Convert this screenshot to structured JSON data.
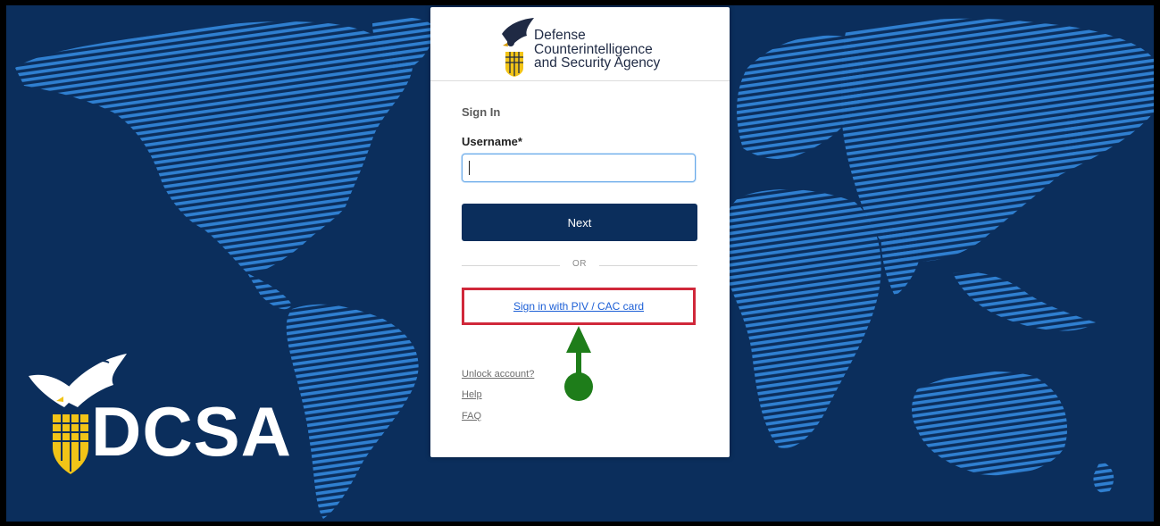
{
  "brand": {
    "wordmark": "DCSA"
  },
  "agency": {
    "line1": "Defense",
    "line2": "Counterintelligence",
    "line3": "and Security Agency"
  },
  "form": {
    "title": "Sign In",
    "username_label": "Username*",
    "username_value": "",
    "next_label": "Next",
    "divider_text": "OR",
    "piv_link": "Sign in with PIV / CAC card"
  },
  "links": {
    "unlock": "Unlock account?",
    "help": "Help",
    "faq": "FAQ"
  },
  "colors": {
    "background": "#0b2e5c",
    "map_lines": "#2f7fd0",
    "highlight": "#d0283a",
    "annotation": "#1e7d1a",
    "seal_gold": "#f2c417"
  },
  "icons": [
    "eagle-icon",
    "shield-icon",
    "arrow-up-icon"
  ]
}
